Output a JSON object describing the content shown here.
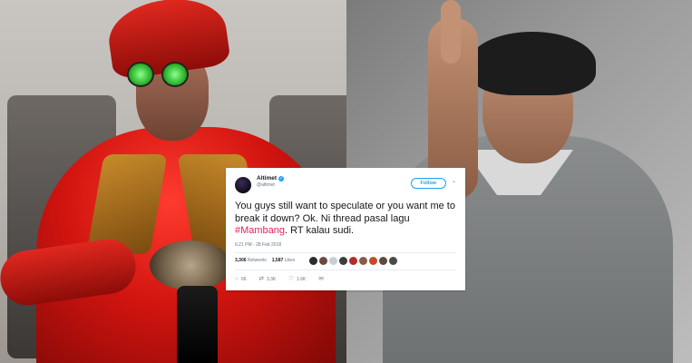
{
  "tweet": {
    "name": "Altimet",
    "handle": "@altimet",
    "follow_label": "Follow",
    "text_before": "You guys still want to speculate or you want me to break it down? Ok. Ni thread pasal lagu ",
    "hashtag": "#Mambang",
    "text_after": ". RT kalau sudi.",
    "timestamp": "6:21 PM - 28 Feb 2018",
    "retweets_count": "3,306",
    "retweets_label": "Retweets",
    "likes_count": "1,587",
    "likes_label": "Likes",
    "reply_count": "66",
    "retweet_action_count": "3.3K",
    "like_action_count": "1.6K",
    "accent_color": "#1da1f2",
    "hashtag_color": "#e0245e",
    "verified_icon": "verified-badge-icon"
  }
}
